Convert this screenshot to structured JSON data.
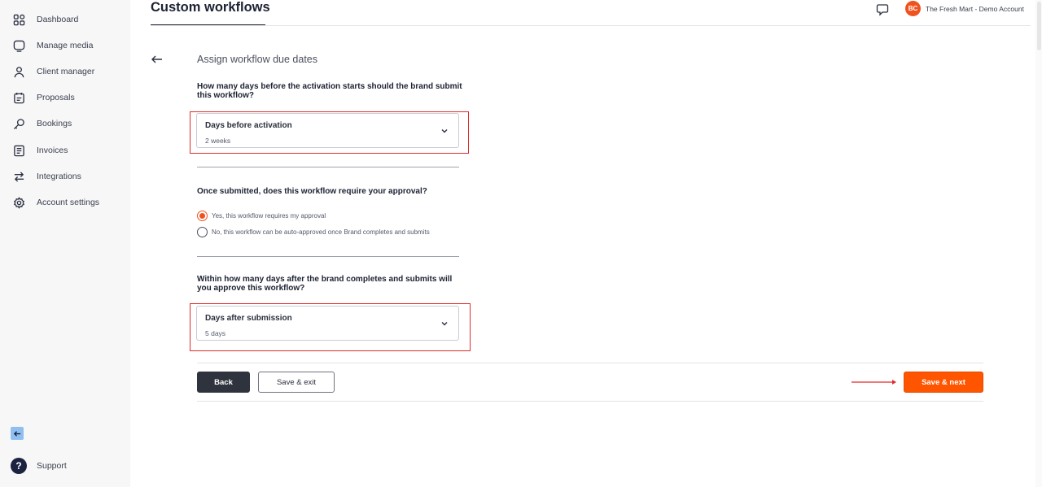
{
  "sidebar": {
    "items": [
      {
        "label": "Dashboard",
        "icon": "grid-icon"
      },
      {
        "label": "Manage media",
        "icon": "media-icon"
      },
      {
        "label": "Client manager",
        "icon": "user-icon"
      },
      {
        "label": "Proposals",
        "icon": "proposal-icon"
      },
      {
        "label": "Bookings",
        "icon": "key-icon"
      },
      {
        "label": "Invoices",
        "icon": "invoice-icon"
      },
      {
        "label": "Integrations",
        "icon": "arrows-icon"
      },
      {
        "label": "Account settings",
        "icon": "gear-icon"
      }
    ],
    "support_label": "Support"
  },
  "header": {
    "title": "Custom workflows",
    "avatar_initials": "BC",
    "account_name": "The Fresh Mart - Demo Account"
  },
  "main": {
    "section_title": "Assign workflow due dates",
    "q1": "How many days before the activation starts should the brand submit this workflow?",
    "select1": {
      "label": "Days before activation",
      "value": "2 weeks"
    },
    "q2": "Once submitted, does this workflow require your approval?",
    "radio_options": [
      {
        "label": "Yes, this workflow requires my approval",
        "selected": true
      },
      {
        "label": "No, this workflow can be auto-approved once Brand completes and submits",
        "selected": false
      }
    ],
    "q3": "Within how many days after the brand completes and submits will you approve this workflow?",
    "select2": {
      "label": "Days after submission",
      "value": "5 days"
    }
  },
  "footer": {
    "back_label": "Back",
    "save_exit_label": "Save & exit",
    "save_next_label": "Save & next"
  },
  "colors": {
    "accent": "#ff5500",
    "highlight": "#e02b2b",
    "dark_button": "#2f333d"
  }
}
